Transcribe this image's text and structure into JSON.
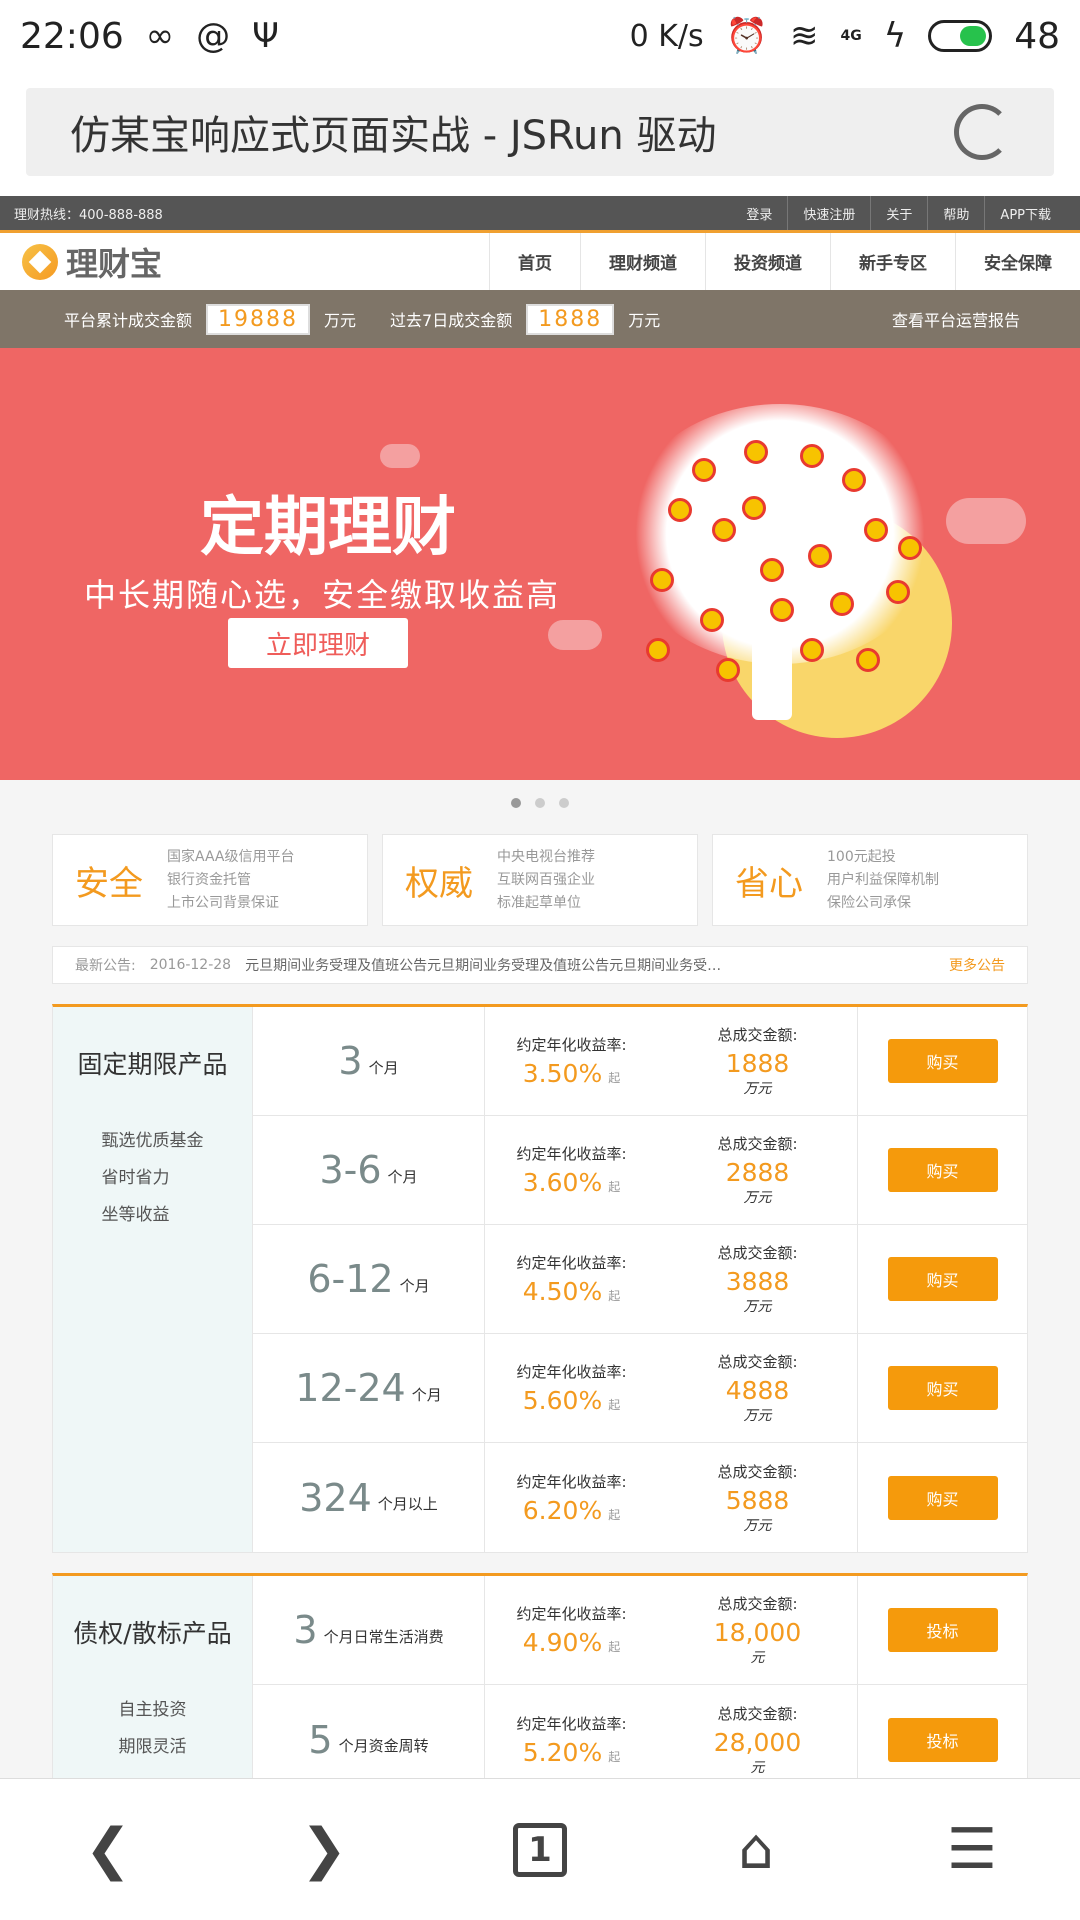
{
  "status": {
    "time": "22:06",
    "speed": "0 K/s",
    "network": "4G",
    "battery": "48"
  },
  "browser": {
    "title": "仿某宝响应式页面实战 - JSRun 驱动"
  },
  "topbar": {
    "hotline": "理财热线：400-888-888",
    "links": [
      "登录",
      "快速注册",
      "关于",
      "帮助",
      "APP下载"
    ]
  },
  "nav": {
    "logo": "理财宝",
    "items": [
      "首页",
      "理财频道",
      "投资频道",
      "新手专区",
      "安全保障"
    ]
  },
  "stats": {
    "total_label": "平台累计成交金额",
    "total_value": "19888",
    "unit1": "万元",
    "week_label": "过去7日成交金额",
    "week_value": "1888",
    "unit2": "万元",
    "report": "查看平台运营报告"
  },
  "banner": {
    "title": "定期理财",
    "subtitle": "中长期随心选，安全缴取收益高",
    "button": "立即理财",
    "active_dot": 1,
    "dot_count": 3
  },
  "features": [
    {
      "big": "安全",
      "lines": [
        "国家AAA级信用平台",
        "银行资金托管",
        "上市公司背景保证"
      ]
    },
    {
      "big": "权威",
      "lines": [
        "中央电视台推荐",
        "互联网百强企业",
        "标准起草单位"
      ]
    },
    {
      "big": "省心",
      "lines": [
        "100元起投",
        "用户利益保障机制",
        "保险公司承保"
      ]
    }
  ],
  "notice": {
    "label": "最新公告:",
    "date": "2016-12-28",
    "text": "元旦期间业务受理及值班公告元旦期间业务受理及值班公告元旦期间业务受…",
    "more": "更多公告"
  },
  "fixed": {
    "title": "固定期限产品",
    "desc": [
      "甄选优质基金",
      "省时省力",
      "坐等收益"
    ],
    "rate_label": "约定年化收益率:",
    "amount_label": "总成交金额:",
    "rate_suffix": "起",
    "rows": [
      {
        "period": "3",
        "unit": "个月",
        "rate": "3.50%",
        "amount": "1888",
        "amount_unit": "万元",
        "button": "购买"
      },
      {
        "period": "3-6",
        "unit": "个月",
        "rate": "3.60%",
        "amount": "2888",
        "amount_unit": "万元",
        "button": "购买"
      },
      {
        "period": "6-12",
        "unit": "个月",
        "rate": "4.50%",
        "amount": "3888",
        "amount_unit": "万元",
        "button": "购买"
      },
      {
        "period": "12-24",
        "unit": "个月",
        "rate": "5.60%",
        "amount": "4888",
        "amount_unit": "万元",
        "button": "购买"
      },
      {
        "period": "324",
        "unit": "个月以上",
        "rate": "6.20%",
        "amount": "5888",
        "amount_unit": "万元",
        "button": "购买"
      }
    ]
  },
  "debt": {
    "title": "债权/散标产品",
    "desc": [
      "自主投资",
      "期限灵活"
    ],
    "rate_label": "约定年化收益率:",
    "amount_label": "总成交金额:",
    "rate_suffix": "起",
    "rows": [
      {
        "period": "3",
        "unit": "个月日常生活消费",
        "rate": "4.90%",
        "amount": "18,000",
        "amount_unit": "元",
        "button": "投标"
      },
      {
        "period": "5",
        "unit": "个月资金周转",
        "rate": "5.20%",
        "amount": "28,000",
        "amount_unit": "元",
        "button": "投标"
      }
    ]
  }
}
